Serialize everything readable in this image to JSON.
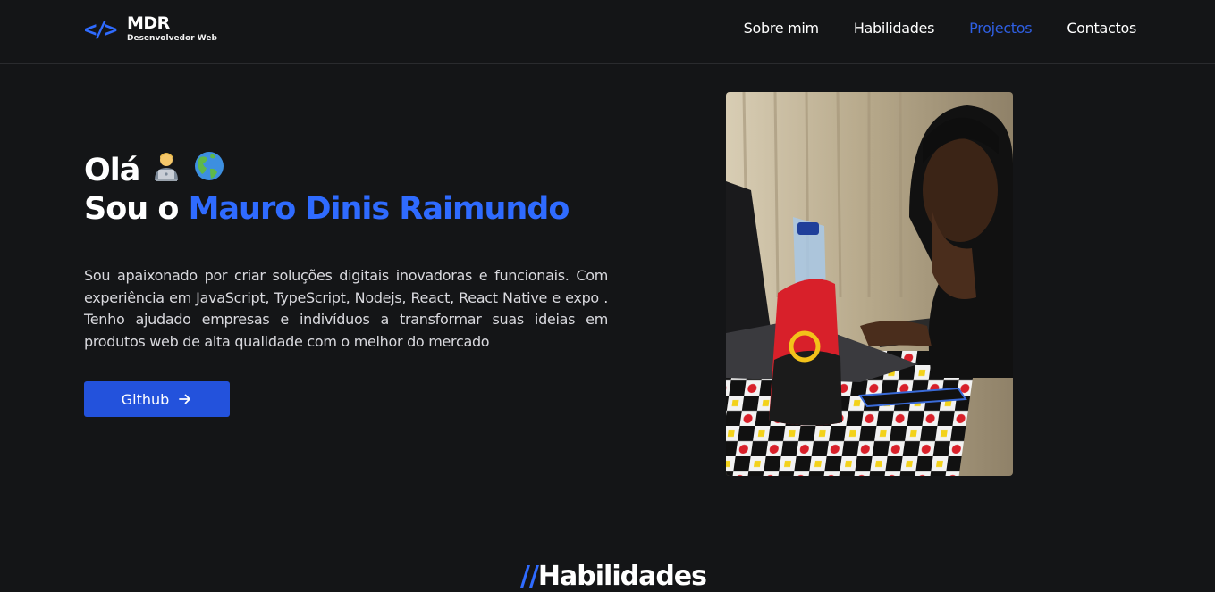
{
  "brand": {
    "icon": "code-brackets-icon",
    "title": "MDR",
    "subtitle": "Desenvolvedor Web"
  },
  "nav": [
    {
      "label": "Sobre mim",
      "active": false
    },
    {
      "label": "Habilidades",
      "active": false
    },
    {
      "label": "Projectos",
      "active": true
    },
    {
      "label": "Contactos",
      "active": false
    }
  ],
  "hero": {
    "greeting": "Olá",
    "emojis": [
      "technologist-icon",
      "globe-americas-icon"
    ],
    "intro": "Sou o",
    "name": "Mauro Dinis Raimundo",
    "bio": "Sou apaixonado por criar soluções digitais inovadoras e funcionais. Com experiência em JavaScript, TypeScript, Nodejs, React, React Native e expo . Tenho ajudado empresas e indivíduos a transformar suas ideias em produtos web de alta qualidade com o melhor do mercado",
    "button_label": "Github",
    "button_icon": "arrow-right-icon"
  },
  "next_section": {
    "prefix": "//",
    "title": "Habilidades"
  },
  "colors": {
    "accent": "#2f6bff",
    "active_nav": "#2f5fe3",
    "button": "#2352dc",
    "background": "#141517"
  }
}
